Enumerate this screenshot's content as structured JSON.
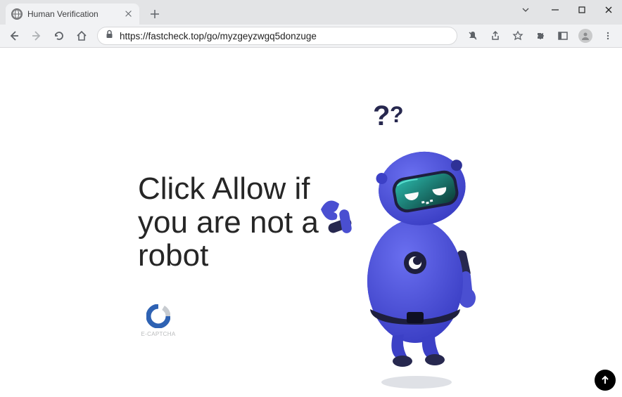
{
  "browser": {
    "tab_title": "Human Verification",
    "url": "https://fastcheck.top/go/myzgeyzwgq5donzuge"
  },
  "page": {
    "heading_line1": "Click Allow if",
    "heading_line2": "you are not a",
    "heading_line3": "robot",
    "captcha_label": "E-CAPTCHA"
  }
}
